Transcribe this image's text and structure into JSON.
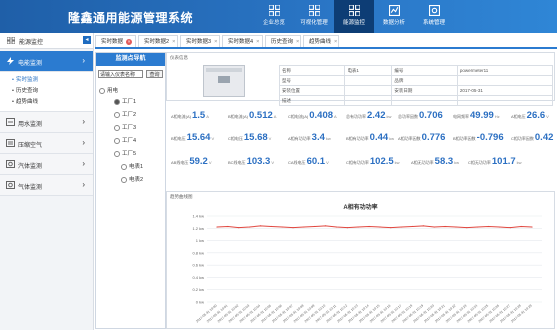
{
  "header": {
    "title": "隆鑫通用能源管理系统",
    "nav": [
      {
        "label": "企业总览",
        "icon": "grid-icon"
      },
      {
        "label": "可视化管理",
        "icon": "grid-icon"
      },
      {
        "label": "能源监控",
        "icon": "grid-icon",
        "active": true
      },
      {
        "label": "数据分析",
        "icon": "chart-icon"
      },
      {
        "label": "系统管理",
        "icon": "settings-icon"
      }
    ]
  },
  "sidebar": {
    "title": "能源监控",
    "collapse": "◂",
    "items": [
      {
        "label": "电能监测",
        "active": true,
        "icon": "lightning-icon"
      },
      {
        "label": "用水监测",
        "icon": "water-icon"
      },
      {
        "label": "压缩空气",
        "icon": "air-icon"
      },
      {
        "label": "汽体监测",
        "icon": "gas-icon"
      },
      {
        "label": "气体监测",
        "icon": "gas-icon"
      }
    ],
    "subitems": [
      {
        "label": "实时监测",
        "active": true
      },
      {
        "label": "历史查询"
      },
      {
        "label": "趋势曲线"
      }
    ]
  },
  "tabs": [
    {
      "label": "实时数据",
      "active": true
    },
    {
      "label": "实时数据2"
    },
    {
      "label": "实时数据3"
    },
    {
      "label": "实时数据4"
    },
    {
      "label": "历史查询"
    },
    {
      "label": "趋势曲线"
    }
  ],
  "tree": {
    "title": "监测点导航",
    "search_placeholder": "请输入仪表名称",
    "search_button": "查询",
    "nodes": [
      "用电",
      "工厂1",
      "工厂2",
      "工厂3",
      "工厂4",
      "工厂5",
      "电表1",
      "电表2"
    ]
  },
  "info": {
    "section_label": "仪表信息",
    "rows": [
      [
        "名称",
        "电表1",
        "编号",
        "powermeter11"
      ],
      [
        "型号",
        "",
        "品牌",
        ""
      ],
      [
        "安装位置",
        "",
        "安装日期",
        "2017-05-31"
      ],
      [
        "描述",
        "",
        "",
        ""
      ]
    ]
  },
  "metrics": [
    {
      "label": "A相电流(A)",
      "value": "1.5",
      "unit": "A"
    },
    {
      "label": "B相电流(A)",
      "value": "0.512",
      "unit": "A"
    },
    {
      "label": "C相电流(A)",
      "value": "0.408",
      "unit": "A"
    },
    {
      "label": "总有功功率",
      "value": "2.42",
      "unit": "kw"
    },
    {
      "label": "总功率因数",
      "value": "0.706",
      "unit": ""
    },
    {
      "label": "电网频率",
      "value": "49.99",
      "unit": "Hz"
    },
    {
      "label": "A相电压",
      "value": "26.6",
      "unit": "V"
    },
    {
      "label": "B相电压",
      "value": "15.64",
      "unit": "V"
    },
    {
      "label": "C相电压",
      "value": "15.68",
      "unit": "V"
    },
    {
      "label": "A相有功功率",
      "value": "3.4",
      "unit": "kw"
    },
    {
      "label": "B相有功功率",
      "value": "0.44",
      "unit": "kw"
    },
    {
      "label": "A相功率因数",
      "value": "0.776",
      "unit": ""
    },
    {
      "label": "B相功率因数",
      "value": "-0.796",
      "unit": ""
    },
    {
      "label": "C相功率因数",
      "value": "0.42",
      "unit": ""
    },
    {
      "label": "AB线电压",
      "value": "59.2",
      "unit": "V"
    },
    {
      "label": "BC线电压",
      "value": "103.3",
      "unit": "V"
    },
    {
      "label": "CA线电压",
      "value": "60.1",
      "unit": "V"
    },
    {
      "label": "C相有功功率",
      "value": "102.5",
      "unit": "kw"
    },
    {
      "label": "A相无功功率",
      "value": "58.3",
      "unit": "kw"
    },
    {
      "label": "C相无功功率",
      "value": "101.7",
      "unit": "kw"
    }
  ],
  "chart_section_label": "趋势曲线图",
  "chart_data": {
    "type": "line",
    "title": "A相有功功率",
    "ylim": [
      0,
      1.4
    ],
    "yticks": [
      "0 kw",
      "0.2 kw",
      "0.4 kw",
      "0.6 kw",
      "0.8 kw",
      "1 kw",
      "1.2 kw",
      "1.4 kw"
    ],
    "series": [
      {
        "color": "#e0473f",
        "values": [
          1.22,
          1.23,
          1.21,
          1.22,
          1.24,
          1.23,
          1.22,
          1.21,
          1.22,
          1.23,
          1.24,
          1.22,
          1.21,
          1.22,
          1.23,
          1.22,
          1.21,
          1.22,
          1.23,
          1.24,
          1.22,
          1.23,
          1.22,
          1.21,
          1.22,
          1.23,
          1.22,
          1.21,
          1.23,
          1.22
        ]
      }
    ],
    "xlabels": [
      "2017-05-31 10:00",
      "2017-05-31 10:01",
      "2017-05-31 10:02",
      "2017-05-31 10:03",
      "2017-05-31 10:04",
      "2017-05-31 10:05",
      "2017-05-31 10:06",
      "2017-05-31 10:07",
      "2017-05-31 10:08",
      "2017-05-31 10:09",
      "2017-05-31 10:10",
      "2017-05-31 10:11",
      "2017-05-31 10:12",
      "2017-05-31 10:13",
      "2017-05-31 10:14",
      "2017-05-31 10:15",
      "2017-05-31 10:16",
      "2017-05-31 10:17",
      "2017-05-31 10:18",
      "2017-05-31 10:19",
      "2017-05-31 10:20",
      "2017-05-31 10:21",
      "2017-05-31 10:22",
      "2017-05-31 10:23",
      "2017-05-31 10:24",
      "2017-05-31 10:25",
      "2017-05-31 10:26",
      "2017-05-31 10:27",
      "2017-05-31 10:28",
      "2017-05-31 10:29"
    ]
  }
}
